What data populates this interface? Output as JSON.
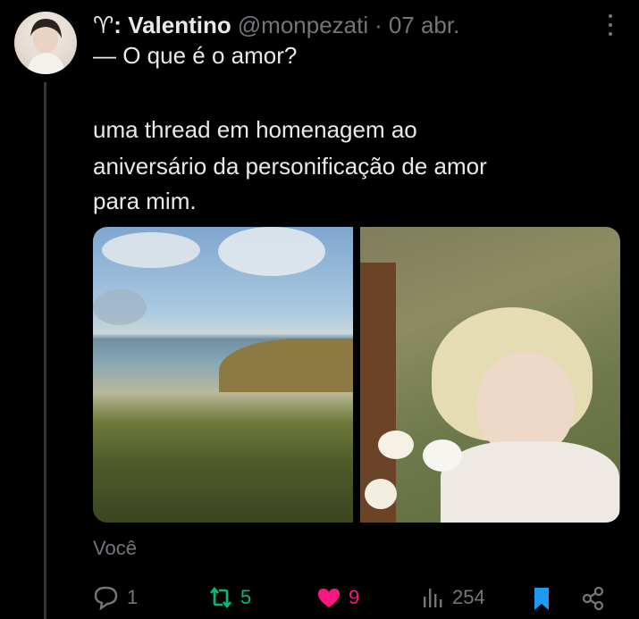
{
  "tweet": {
    "display_name": "♈︎: Valentino",
    "handle": "@monpezati",
    "separator": "·",
    "date": "07 abr.",
    "text_line1": "— O que é o amor?",
    "text_line2": "uma thread em homenagem ao",
    "text_line3": "aniversário da personificação de amor",
    "text_line4": "para mim.",
    "audience_label": "Você"
  },
  "actions": {
    "replies": "1",
    "retweets": "5",
    "likes": "9",
    "views": "254"
  },
  "colors": {
    "background": "#000000",
    "text": "#e7e9ea",
    "secondary": "#71767b",
    "reply": "#71767b",
    "retweet": "#00ba7c",
    "like": "#f91880",
    "bookmark": "#1d9bf0"
  }
}
